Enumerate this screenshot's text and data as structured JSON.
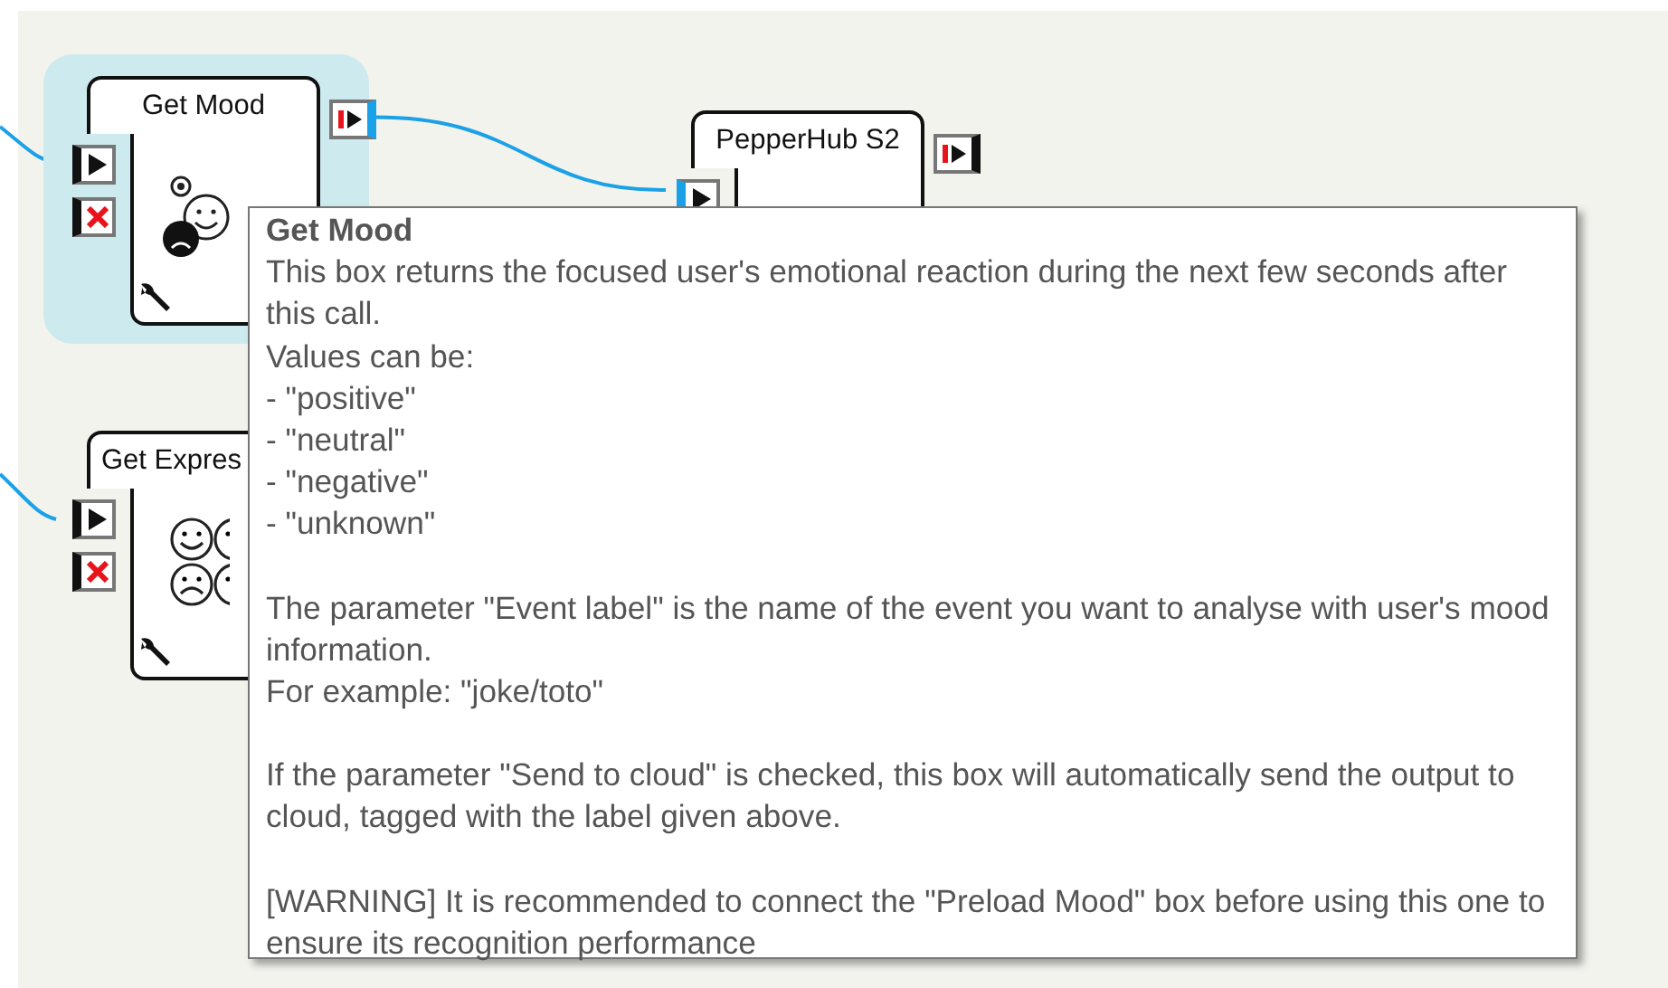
{
  "canvas": {
    "nodes": [
      {
        "title": "Get Mood",
        "kind": "mood",
        "selected": true,
        "inputs": [
          {
            "kind": "play"
          },
          {
            "kind": "stop"
          }
        ],
        "outputs": [
          {
            "kind": "signal"
          }
        ]
      },
      {
        "title": "Get Expres",
        "kind": "expression",
        "selected": false,
        "inputs": [
          {
            "kind": "play"
          },
          {
            "kind": "stop"
          }
        ]
      },
      {
        "title": "PepperHub S2",
        "kind": "hub",
        "selected": false,
        "inputs": [
          {
            "kind": "play"
          }
        ],
        "outputs": [
          {
            "kind": "signal"
          }
        ]
      }
    ]
  },
  "tooltip": {
    "title": "Get Mood",
    "paragraphs": [
      [
        "This box returns the focused user's emotional reaction during the next few seconds after this call.",
        "Values can be:",
        "- \"positive\"",
        "- \"neutral\"",
        "- \"negative\"",
        "- \"unknown\""
      ],
      [
        "The parameter \"Event label\" is the name of the event you want to analyse with user's mood information.",
        "For example: \"joke/toto\""
      ],
      [
        "If the parameter \"Send to cloud\" is checked, this box will automatically send the output to cloud, tagged with the label given above."
      ],
      [
        "[WARNING] It is recommended to connect the \"Preload Mood\" box before using this one to ensure its recognition performance"
      ]
    ]
  }
}
